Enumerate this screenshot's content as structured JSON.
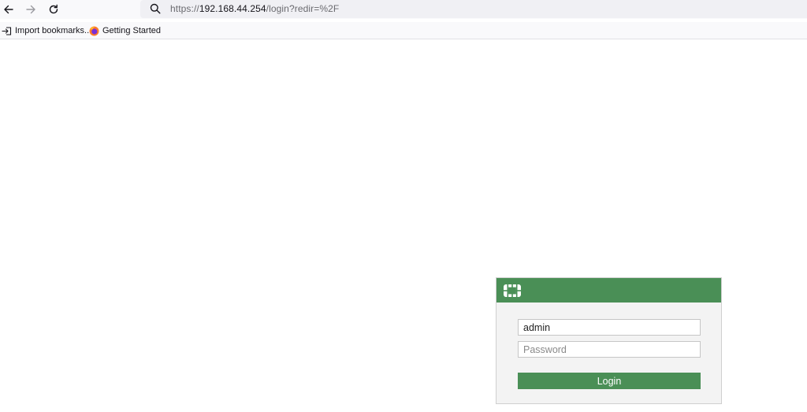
{
  "browser": {
    "back_icon": "arrow-left-icon",
    "forward_icon": "arrow-right-icon",
    "reload_icon": "reload-icon",
    "url": {
      "scheme": "https://",
      "host": "192.168.44.254",
      "path": "/login?redir=%2F"
    }
  },
  "bookmarks": {
    "items": [
      {
        "label": "Import bookmarks...",
        "icon": "import-icon"
      },
      {
        "label": "Getting Started",
        "icon": "firefox-icon"
      }
    ]
  },
  "login": {
    "brand_color": "#4a8f56",
    "logo_icon": "fortinet-logo-icon",
    "username_value": "admin",
    "password_placeholder": "Password",
    "login_label": "Login"
  }
}
